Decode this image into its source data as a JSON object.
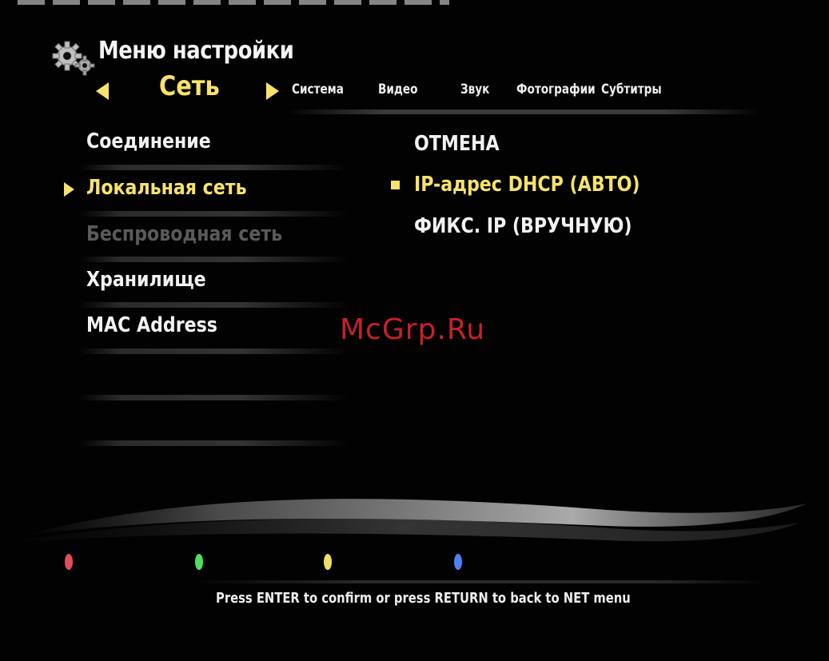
{
  "header": {
    "title": "Меню настройки",
    "icon": "gears-icon"
  },
  "tabs": {
    "active": "Сеть",
    "items": [
      "Система",
      "Видео",
      "Звук",
      "Фотографии",
      "Субтитры"
    ]
  },
  "left_menu": {
    "items": [
      {
        "label": "Соединение",
        "state": "normal"
      },
      {
        "label": "Локальная сеть",
        "state": "selected"
      },
      {
        "label": "Беспроводная сеть",
        "state": "disabled"
      },
      {
        "label": "Хранилище",
        "state": "normal"
      },
      {
        "label": "MAC Address",
        "state": "normal"
      }
    ]
  },
  "options": {
    "items": [
      {
        "label": "ОТМЕНА",
        "state": "normal"
      },
      {
        "label": "IP-адрес DHCP (АВТО)",
        "state": "selected"
      },
      {
        "label": "ФИКС. IP (ВРУЧНУЮ)",
        "state": "normal"
      }
    ]
  },
  "watermark": "McGrp.Ru",
  "color_keys": [
    {
      "name": "red",
      "color": "#e0505a"
    },
    {
      "name": "green",
      "color": "#50e060"
    },
    {
      "name": "yellow",
      "color": "#f0e060"
    },
    {
      "name": "blue",
      "color": "#5080f0"
    }
  ],
  "hint": "Press ENTER to confirm or press RETURN to back to NET menu",
  "colors": {
    "highlight": "#f7e36a",
    "disabled": "#5a5a5a",
    "watermark": "#c8202a"
  }
}
